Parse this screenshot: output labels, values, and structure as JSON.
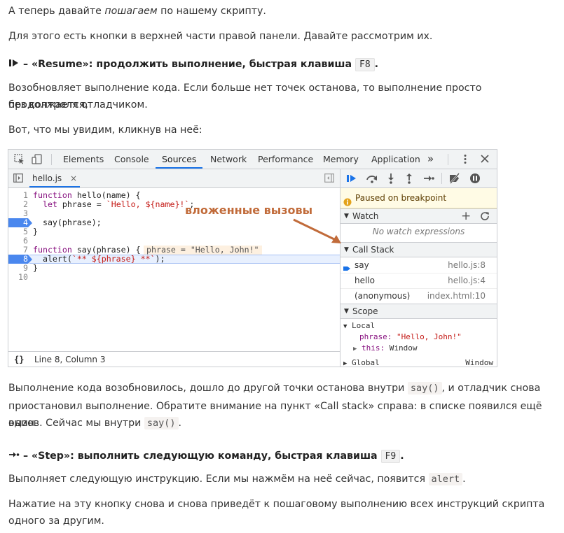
{
  "intro": {
    "p1_a": "А теперь давайте ",
    "p1_em": "пошагаем",
    "p1_b": " по нашему скрипту.",
    "p2": "Для этого есть кнопки в верхней части правой панели. Давайте рассмотрим их."
  },
  "resume": {
    "heading": " – «Resume»: продолжить выполнение, быстрая клавиша ",
    "key": "F8",
    "dot": ".",
    "desc1": "Возобновляет выполнение кода. Если больше нет точек останова, то выполнение просто продолжается,",
    "desc2": "без контроля отладчиком.",
    "see": "Вот, что мы увидим, кликнув на неё:"
  },
  "devtools": {
    "tabs": [
      "Elements",
      "Console",
      "Sources",
      "Network",
      "Performance",
      "Memory",
      "Application"
    ],
    "more": "»",
    "file_tab": "hello.js",
    "file_close": "×",
    "code_lines": [
      {
        "n": "1",
        "text": "function hello(name) {"
      },
      {
        "n": "2",
        "text": "  let phrase = `Hello, ${name}!`;"
      },
      {
        "n": "3",
        "text": ""
      },
      {
        "n": "4",
        "text": "  say(phrase);"
      },
      {
        "n": "5",
        "text": "}"
      },
      {
        "n": "6",
        "text": ""
      },
      {
        "n": "7",
        "text": "function say(phrase) {"
      },
      {
        "n": "8",
        "text": "  alert(`** ${phrase} **`);"
      },
      {
        "n": "9",
        "text": "}"
      },
      {
        "n": "10",
        "text": ""
      }
    ],
    "inline_value": "phrase = \"Hello, John!\"",
    "annotation": "вложенные вызовы",
    "status_icon": "{}",
    "status_text": "Line 8, Column 3",
    "paused": "Paused on breakpoint",
    "watch": "Watch",
    "watch_empty": "No watch expressions",
    "call_stack": "Call Stack",
    "frames": [
      {
        "name": "say",
        "loc": "hello.js:8"
      },
      {
        "name": "hello",
        "loc": "hello.js:4"
      },
      {
        "name": "(anonymous)",
        "loc": "index.html:10"
      }
    ],
    "scope": "Scope",
    "local": "Local",
    "phrase_key": "phrase:",
    "phrase_val": "\"Hello, John!\"",
    "this_key": "this:",
    "this_val": "Window",
    "global": "Global",
    "global_val": "Window"
  },
  "after_resume": {
    "l1_a": "Выполнение кода возобновилось, дошло до другой точки останова внутри ",
    "l1_code": "say()",
    "l1_b": ", и отладчик снова",
    "l2": "приостановил выполнение. Обратите внимание на пункт «Call stack» справа: в списке появился ещё один",
    "l3_a": "вызов. Сейчас мы внутри ",
    "l3_code": "say()",
    "l3_b": "."
  },
  "step": {
    "heading": " – «Step»: выполнить следующую команду, быстрая клавиша ",
    "key": "F9",
    "dot": ".",
    "desc_a": "Выполняет следующую инструкцию. Если мы нажмём на неё сейчас, появится ",
    "desc_code": "alert",
    "desc_b": ".",
    "p1": "Нажатие на эту кнопку снова и снова приведёт к пошаговому выполнению всех инструкций скрипта",
    "p2": "одного за другим."
  }
}
